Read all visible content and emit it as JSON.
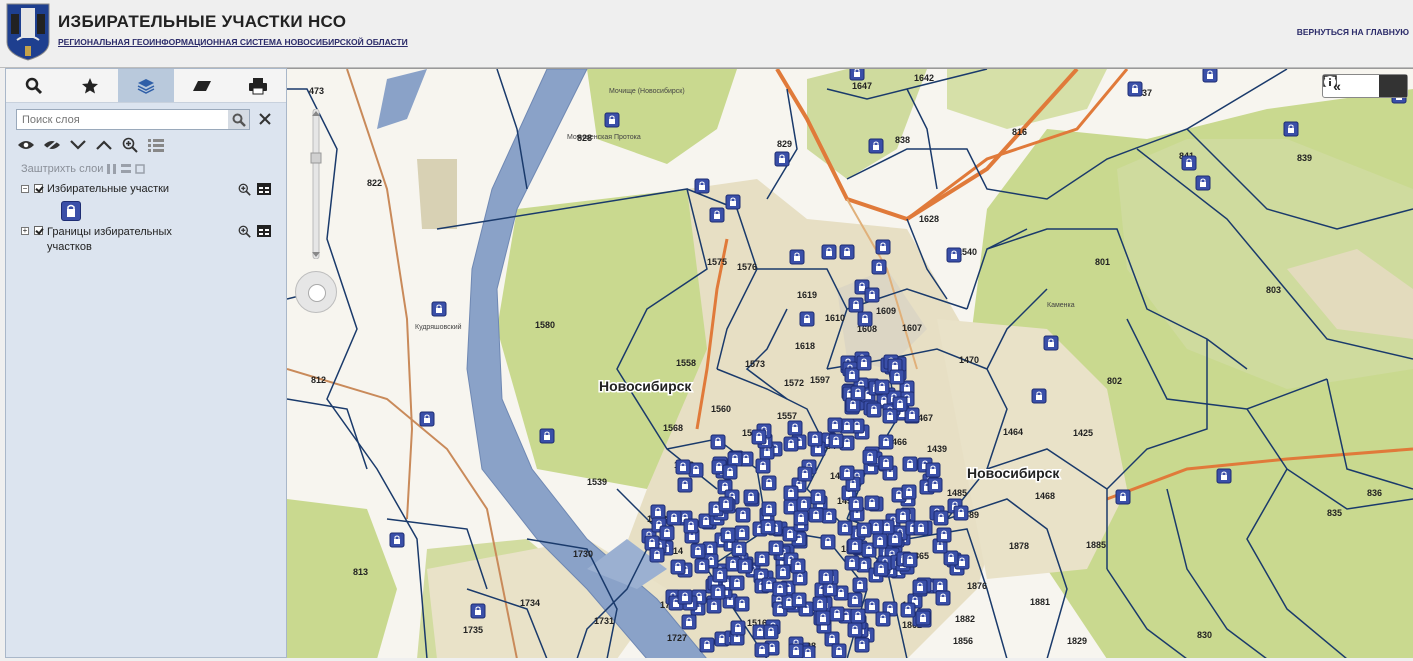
{
  "header": {
    "title": "ИЗБИРАТЕЛЬНЫЕ УЧАСТКИ НСО",
    "subtitle": "РЕГИОНАЛЬНАЯ ГЕОИНФОРМАЦИОННАЯ СИСТЕМА НОВОСИБИРСКОЙ ОБЛАСТИ",
    "back_link": "ВЕРНУТЬСЯ НА ГЛАВНУЮ"
  },
  "toolbar": {
    "tabs": [
      "search-icon",
      "star-icon",
      "layers-icon",
      "eraser-icon",
      "print-icon"
    ],
    "active_tab": "layers-icon"
  },
  "layer_panel": {
    "search_placeholder": "Поиск слоя",
    "shade_label": "Заштрихть слои",
    "layers": [
      {
        "label": "Избирательные участки"
      },
      {
        "label": "Границы избирательных участков"
      }
    ]
  },
  "map": {
    "city_labels": [
      "Новосибирск",
      "Новосибирск"
    ],
    "small_labels": [
      "Мочище (Новосибирск)",
      "Мочищенская Протока",
      "Кудряшовский",
      "Каменка"
    ],
    "precinct_numbers": [
      "473",
      "1647",
      "1642",
      "837",
      "829",
      "838",
      "816",
      "841",
      "839",
      "822",
      "828",
      "1628",
      "1575",
      "1576",
      "801",
      "1540",
      "1619",
      "1610",
      "1609",
      "1608",
      "1607",
      "803",
      "1580",
      "1618",
      "1470",
      "1558",
      "1573",
      "1597",
      "1572",
      "1467",
      "802",
      "812",
      "1560",
      "1557",
      "1568",
      "1565",
      "1584",
      "1466",
      "1464",
      "1425",
      "1439",
      "1548",
      "1459",
      "1539",
      "1456",
      "1485",
      "1468",
      "836",
      "1538",
      "1489",
      "835",
      "1514",
      "1894",
      "1865",
      "1878",
      "1885",
      "1730",
      "1876",
      "813",
      "1734",
      "1728",
      "1863",
      "1881",
      "1882",
      "1731",
      "1735",
      "1727",
      "1862",
      "1856",
      "1829",
      "830",
      "1516",
      "1828"
    ],
    "colors": {
      "water": "#8aa2c8",
      "forest": "#c9d98f",
      "urban": "#e9e2c8",
      "boundary": "#1a3a6b",
      "road": "#e07a3a",
      "marker": "#3a4fa8"
    }
  }
}
